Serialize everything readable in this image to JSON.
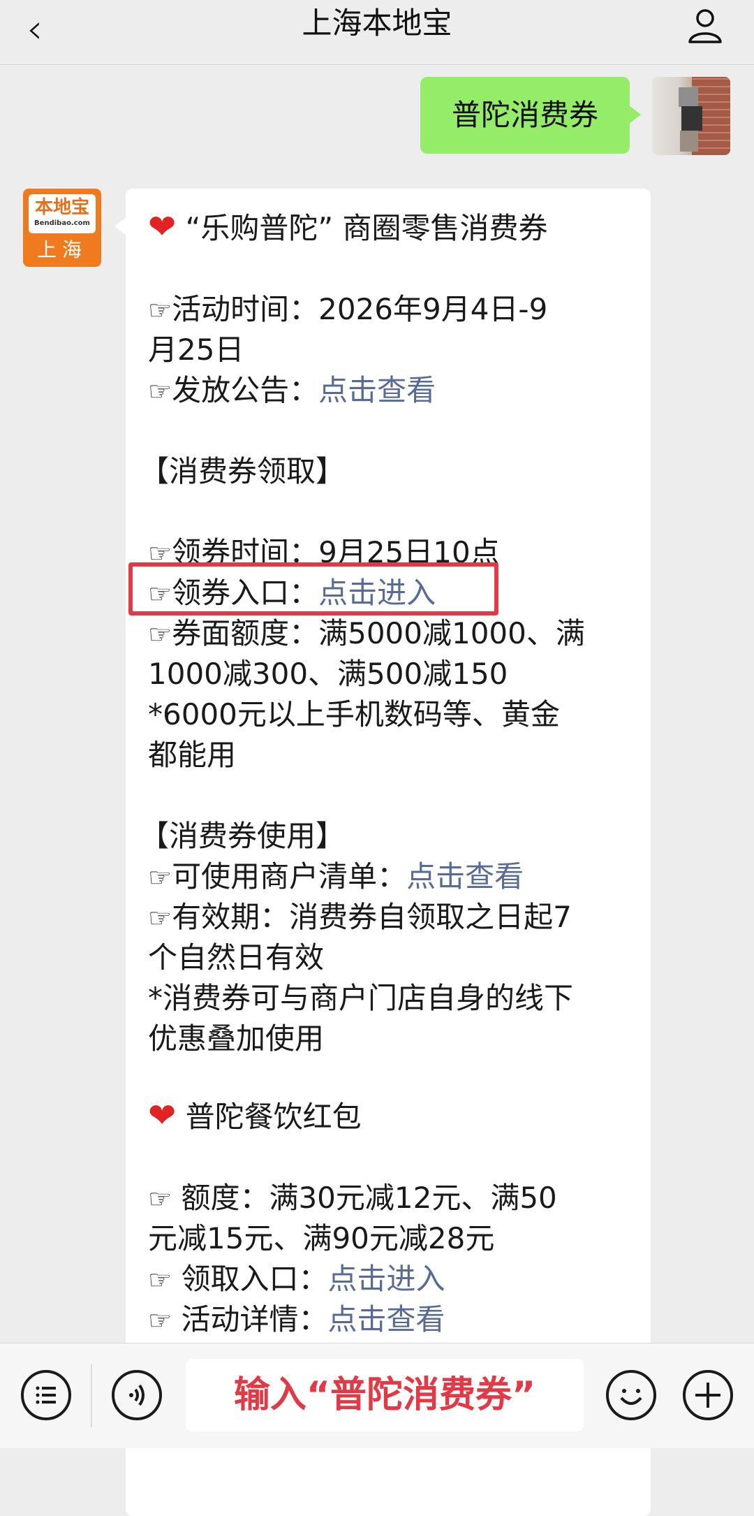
{
  "header": {
    "back_icon": "chevron-left-icon",
    "title": "上海本地宝",
    "profile_icon": "user-icon"
  },
  "sent_message": {
    "text": "普陀消费券"
  },
  "bot": {
    "avatar_top": "本地宝",
    "avatar_url": "Bendibao.com",
    "avatar_city": "上海"
  },
  "message": {
    "section1_title": "“乐购普陀” 商圈零售消费券",
    "activity_time_label": "活动时间：",
    "activity_time_line1": "2026年9月4日-9",
    "activity_time_line2": "月25日",
    "notice_label": "发放公告：",
    "notice_link": "点击查看",
    "coupon_claim_title": "【消费券领取】",
    "claim_time_label": "领券时间：",
    "claim_time_value": "9月25日10点",
    "claim_entry_label": "领券入口：",
    "claim_entry_link": "点击进入",
    "face_value_label": "券面额度：",
    "face_value_line1": "满5000减1000、满",
    "face_value_line2": "1000减300、满500减150",
    "note1_line1": "*6000元以上手机数码等、黄金",
    "note1_line2": "都能用",
    "coupon_use_title": "【消费券使用】",
    "merchant_list_label": "可使用商户清单：",
    "merchant_list_link": "点击查看",
    "validity_label": "有效期：",
    "validity_line1": "消费券自领取之日起7",
    "validity_line2": "个自然日有效",
    "note2_line1": "*消费券可与商户门店自身的线下",
    "note2_line2": "优惠叠加使用",
    "section2_title": "普陀餐饮红包",
    "amount_label": "额度：",
    "amount_line1": "满30元减12元、满50",
    "amount_line2": "元减15元、满90元减28元",
    "receive_entry_label": "领取入口：",
    "receive_entry_link": "点击进入",
    "details_label": "活动详情：",
    "details_link": "点击查看"
  },
  "bottom_bar": {
    "input_text": "输入“普陀消费券”"
  },
  "colors": {
    "background": "#ededed",
    "sent_bubble": "#95ec69",
    "link": "#576b95",
    "highlight": "#e03a47",
    "heart": "#e02424"
  }
}
